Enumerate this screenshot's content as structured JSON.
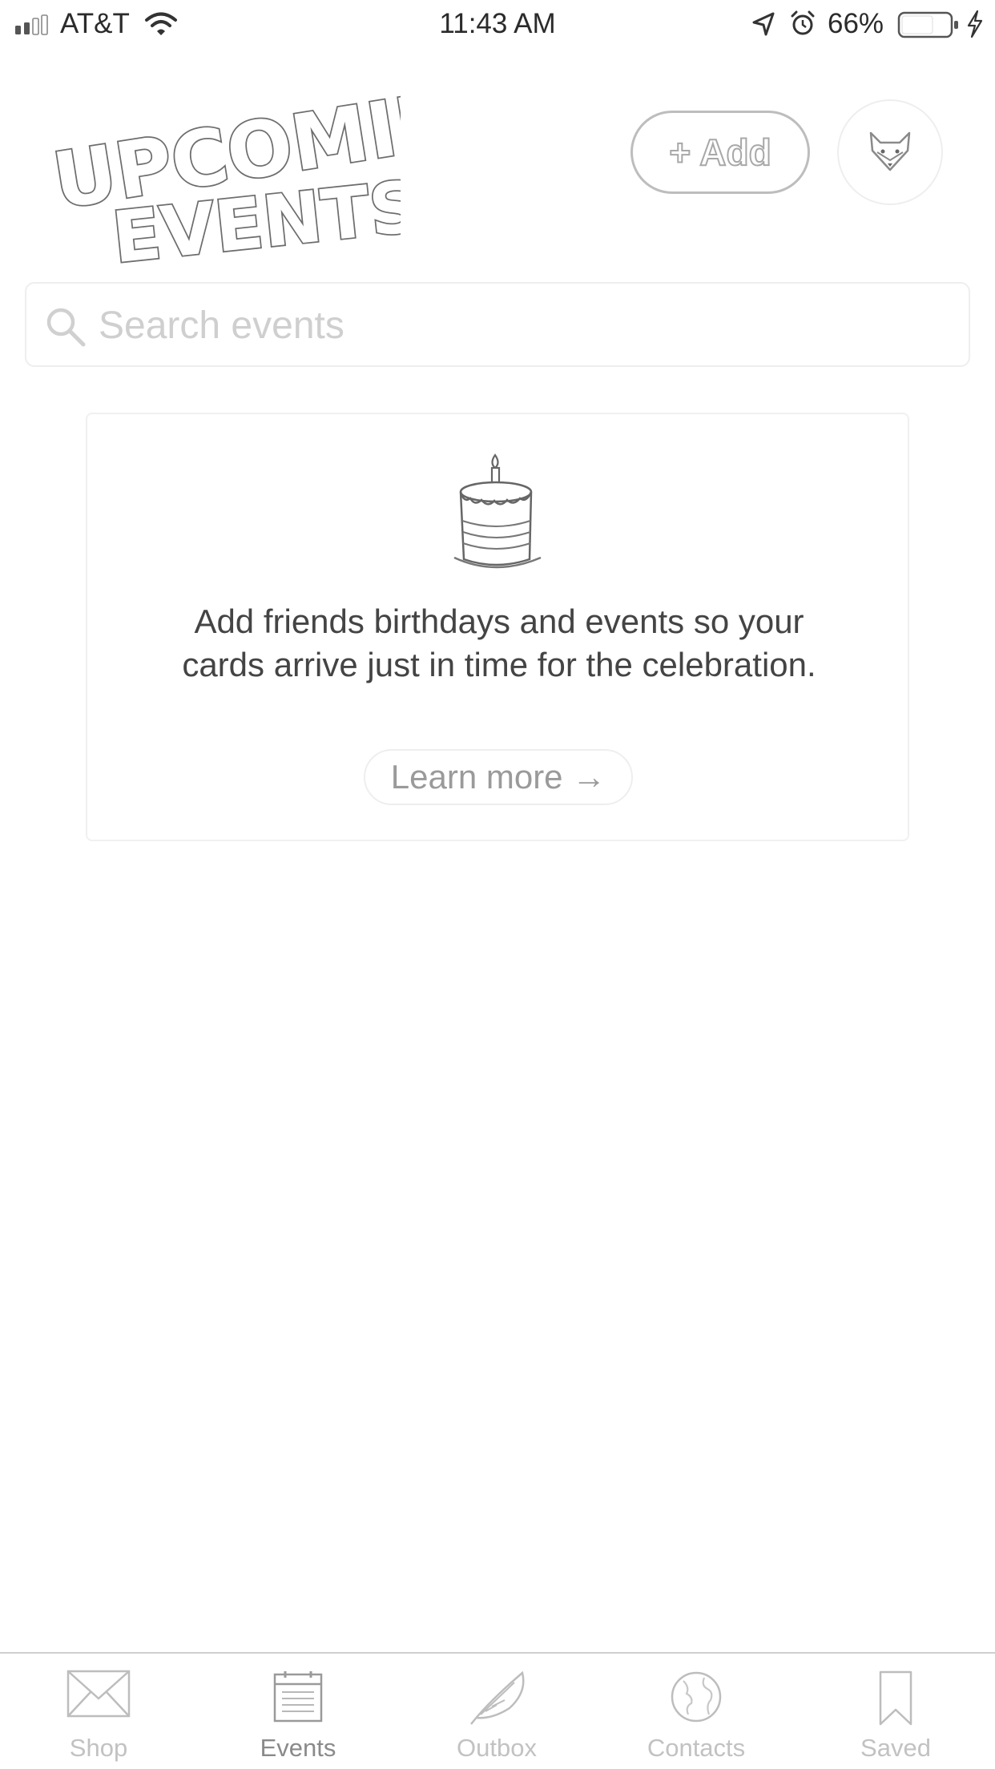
{
  "status_bar": {
    "carrier": "AT&T",
    "time": "11:43 AM",
    "battery_percent": "66%",
    "battery_level": 0.66,
    "signal_bars_filled": 2,
    "signal_bars_total": 4
  },
  "header": {
    "title_line1": "UPCOMING",
    "title_line2": "EVENTS",
    "add_button_label": "+ Add",
    "avatar_icon": "fox-icon"
  },
  "search": {
    "placeholder": "Search events",
    "value": ""
  },
  "empty_state": {
    "icon": "cake-icon",
    "message": "Add friends birthdays and events so your cards arrive just in time for the celebration.",
    "learn_more_label": "Learn more →"
  },
  "tab_bar": {
    "active": "Events",
    "tabs": [
      {
        "label": "Shop",
        "icon": "envelope-icon"
      },
      {
        "label": "Events",
        "icon": "calendar-icon"
      },
      {
        "label": "Outbox",
        "icon": "feather-icon"
      },
      {
        "label": "Contacts",
        "icon": "globe-icon"
      },
      {
        "label": "Saved",
        "icon": "bookmark-icon"
      }
    ]
  },
  "colors": {
    "background": "#ffffff",
    "text": "#444444",
    "muted": "#c2c2c2",
    "active_tab": "#8a8a8a",
    "border": "#eeeeee"
  }
}
